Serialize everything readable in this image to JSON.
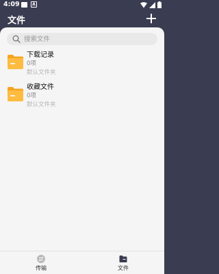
{
  "status_bar": {
    "time": "4:09",
    "badge_letter": "A"
  },
  "header": {
    "title": "文件",
    "add_icon": "plus-icon"
  },
  "search": {
    "placeholder": "搜索文件",
    "value": ""
  },
  "folders": [
    {
      "name": "下载记录",
      "count": "0项",
      "type": "默认文件夹"
    },
    {
      "name": "收藏文件",
      "count": "0项",
      "type": "默认文件夹"
    }
  ],
  "bottom_nav": {
    "tabs": [
      {
        "label": "传输",
        "icon": "transfer-icon"
      },
      {
        "label": "文件",
        "icon": "folder-icon"
      }
    ],
    "active": "文件"
  },
  "colors": {
    "header_bg": "#3a3c51",
    "panel_bg": "#f5f5f5",
    "folder_body": "#fdbc40",
    "folder_tab": "#f4a51f"
  }
}
